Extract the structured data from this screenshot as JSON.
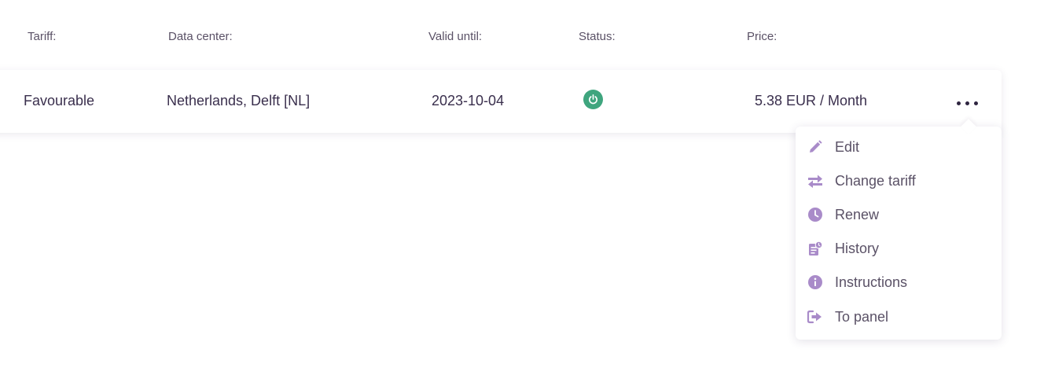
{
  "headers": {
    "tariff": "Tariff:",
    "data_center": "Data center:",
    "valid_until": "Valid until:",
    "status": "Status:",
    "price": "Price:"
  },
  "row": {
    "tariff": "Favourable",
    "data_center": "Netherlands, Delft [NL]",
    "valid_until": "2023-10-04",
    "status_icon": "power-icon",
    "price": "5.38 EUR / Month"
  },
  "menu": {
    "items": [
      {
        "label": "Edit",
        "icon": "pencil-icon"
      },
      {
        "label": "Change tariff",
        "icon": "swap-arrows-icon"
      },
      {
        "label": "Renew",
        "icon": "clock-icon"
      },
      {
        "label": "History",
        "icon": "history-icon"
      },
      {
        "label": "Instructions",
        "icon": "info-icon"
      },
      {
        "label": "To panel",
        "icon": "sign-in-icon"
      }
    ]
  },
  "colors": {
    "status_active": "#3fa57e",
    "menu_icon": "#a98bc9",
    "text_primary": "#3a2f4d",
    "text_secondary": "#5a5166"
  }
}
